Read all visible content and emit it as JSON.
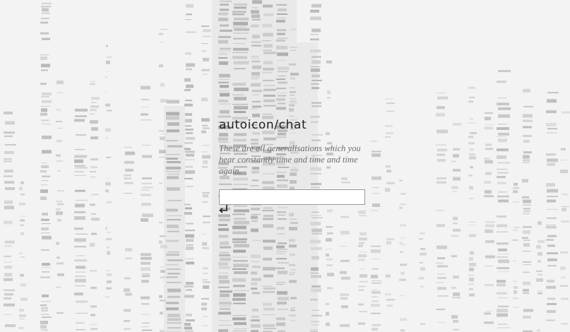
{
  "app": {
    "logo_text": "autoicon/chat"
  },
  "chat": {
    "quote": "These are all generalisations which you hear constantly time and time and time again.",
    "input_value": "",
    "input_placeholder": ""
  },
  "icons": {
    "enter": "enter-return-icon",
    "background": "barcode-glitch-pattern"
  },
  "colors": {
    "background": "#f3f3f3",
    "logo": "#1f1f1f",
    "quote": "#6e6e6e",
    "input_border": "#9a9a9a"
  }
}
